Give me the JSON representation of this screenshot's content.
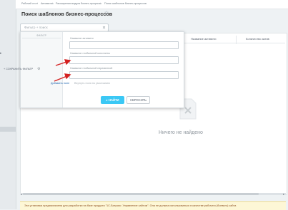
{
  "breadcrumbs": [
    "Рабочий стол",
    "Автоматиз",
    "Расширения модуля бизнес-процессы",
    "Поиск шаблонов бизнес-процессов"
  ],
  "page_title": "Поиск шаблонов бизнес-процессов",
  "search": {
    "placeholder": "Фильтр + поиск"
  },
  "columns": [
    "Название активити",
    "Количество актив"
  ],
  "filter_popup": {
    "side_header": "ФИЛЬТР",
    "save_filter_label": "СОХРАНИТЬ ФИЛЬТР",
    "fields": [
      {
        "label": "Название активити",
        "value": ""
      },
      {
        "label": "Название глобальной константы",
        "value": ""
      },
      {
        "label": "Название глобальной переменной",
        "value": ""
      }
    ],
    "add_field_label": "Добавить поле",
    "reset_default_label": "Вернуть поля по умолчанию",
    "find_button": "НАЙТИ",
    "reset_button": "СБРОСИТЬ"
  },
  "empty_state": "Ничего не найдено",
  "notice": "Эта установка предназначена для разработки на базе продукта \"1С-Битрикс: Управление сайтом\". Она не должна использоваться в качестве рабочего (боевого) сайта",
  "colors": {
    "accent": "#3bc8f5",
    "annotation_arrow": "#d42020",
    "link": "#2067b0"
  }
}
